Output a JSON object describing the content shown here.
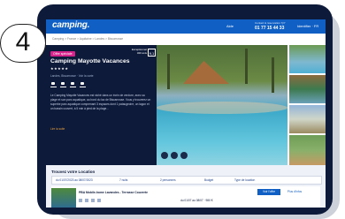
{
  "step_number": "4",
  "header": {
    "logo": "camping.",
    "help": "Aide",
    "phone_caption": "Contact & réservation 7j/7",
    "phone": "01 77 15 44 33",
    "user": "Identifier · FR"
  },
  "breadcrumb": "Camping > France > Aquitaine > Landes > Biscarrosse",
  "listing": {
    "badge": "Offre spéciale",
    "title": "Camping Mayotte Vacances",
    "stars": "★★★★★",
    "location": "Landes, Biscarrosse · Voir la carte",
    "rating_label": "Exceptionnel 320 avis",
    "rating_score": "9,1",
    "description": "Le Camping Mayotte Vacances est niché dans un écrin de verdure, avec sa plage et son parc aquatique, au bord du lac de Biscarrosse. Vous y trouverez un superbe parc aquatique comprenant 3 espaces dont 1 pataugeoire, un lagon et un bassin couvert, à 5 min à pied de la plage…",
    "more": "Lire la suite"
  },
  "booking": {
    "section_title": "Trouvez votre Location",
    "filters": [
      "du 01/07/2023 au 08/07/2023",
      "7 nuits",
      "2 personnes",
      "Budget",
      "Type de location"
    ],
    "result": {
      "title": "PBA Mobile-home Lavandes - Terrasse Couverte",
      "price": "du 01/07 au 08/07 · 980 €",
      "cta": "Voir l'offre",
      "secondary": "Plus d'infos"
    }
  }
}
